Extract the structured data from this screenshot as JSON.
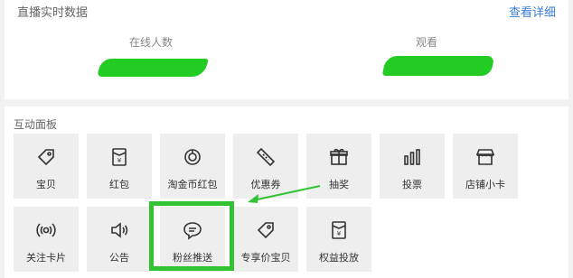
{
  "live": {
    "title": "直播实时数据",
    "detail_link": "查看详细",
    "online_label": "在线人数",
    "watch_label": "观看"
  },
  "panel": {
    "title": "互动面板",
    "tiles": [
      {
        "label": "宝贝",
        "icon": "tag-icon"
      },
      {
        "label": "红包",
        "icon": "red-envelope-icon"
      },
      {
        "label": "淘金币红包",
        "icon": "coin-envelope-icon"
      },
      {
        "label": "优惠券",
        "icon": "coupon-icon"
      },
      {
        "label": "抽奖",
        "icon": "gift-icon"
      },
      {
        "label": "投票",
        "icon": "bar-chart-icon"
      },
      {
        "label": "店铺小卡",
        "icon": "store-icon"
      },
      {
        "label": "关注卡片",
        "icon": "broadcast-icon"
      },
      {
        "label": "公告",
        "icon": "speaker-icon"
      },
      {
        "label": "粉丝推送",
        "icon": "chat-bubble-icon"
      },
      {
        "label": "专享价宝贝",
        "icon": "price-tag-icon"
      },
      {
        "label": "权益投放",
        "icon": "rights-envelope-icon"
      }
    ]
  },
  "colors": {
    "highlight": "#33c233",
    "link": "#3a7bd5",
    "redaction": "#22cc22"
  }
}
